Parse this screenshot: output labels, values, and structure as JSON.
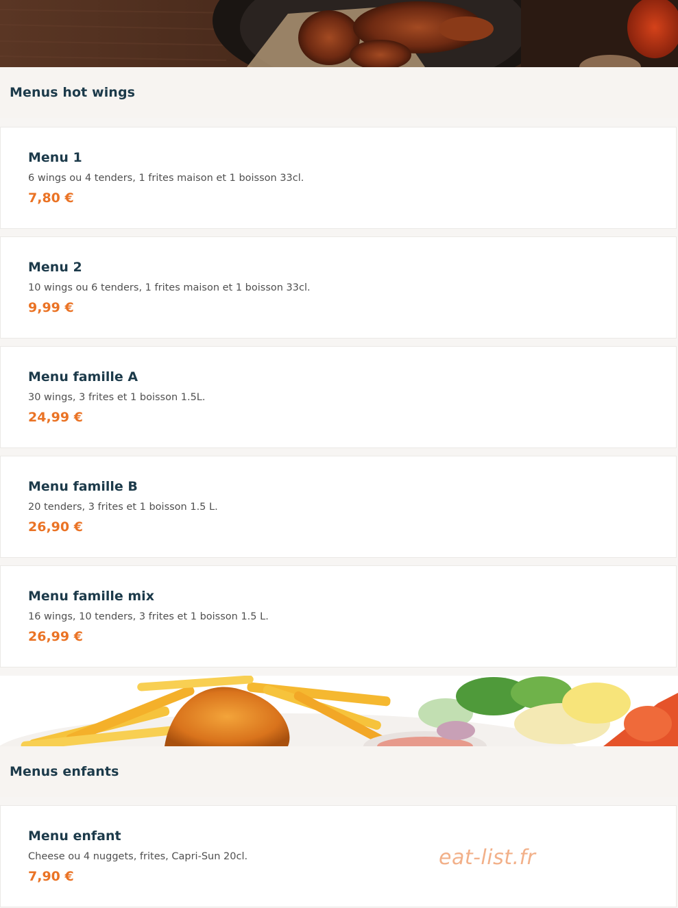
{
  "sections": [
    {
      "title": "Menus hot wings",
      "items": [
        {
          "name": "Menu 1",
          "description": "6 wings ou 4 tenders, 1 frites maison et 1 boisson 33cl.",
          "price": "7,80 €"
        },
        {
          "name": "Menu 2",
          "description": "10 wings ou 6 tenders, 1 frites maison et 1 boisson 33cl.",
          "price": "9,99 €"
        },
        {
          "name": "Menu famille A",
          "description": "30 wings, 3 frites et 1 boisson 1.5L.",
          "price": "24,99 €"
        },
        {
          "name": "Menu famille B",
          "description": "20 tenders, 3 frites et 1 boisson 1.5 L.",
          "price": "26,90 €"
        },
        {
          "name": "Menu famille mix",
          "description": "16 wings, 10 tenders, 3 frites et 1 boisson 1.5 L.",
          "price": "26,99 €"
        }
      ]
    },
    {
      "title": "Menus enfants",
      "items": [
        {
          "name": "Menu enfant",
          "description": "Cheese ou 4 nuggets, frites, Capri-Sun 20cl.",
          "price": "7,90 €"
        }
      ]
    }
  ],
  "watermark": "eat-list.fr",
  "colors": {
    "heading": "#1c3a4a",
    "price": "#ea7325",
    "text": "#4f4f4f"
  }
}
